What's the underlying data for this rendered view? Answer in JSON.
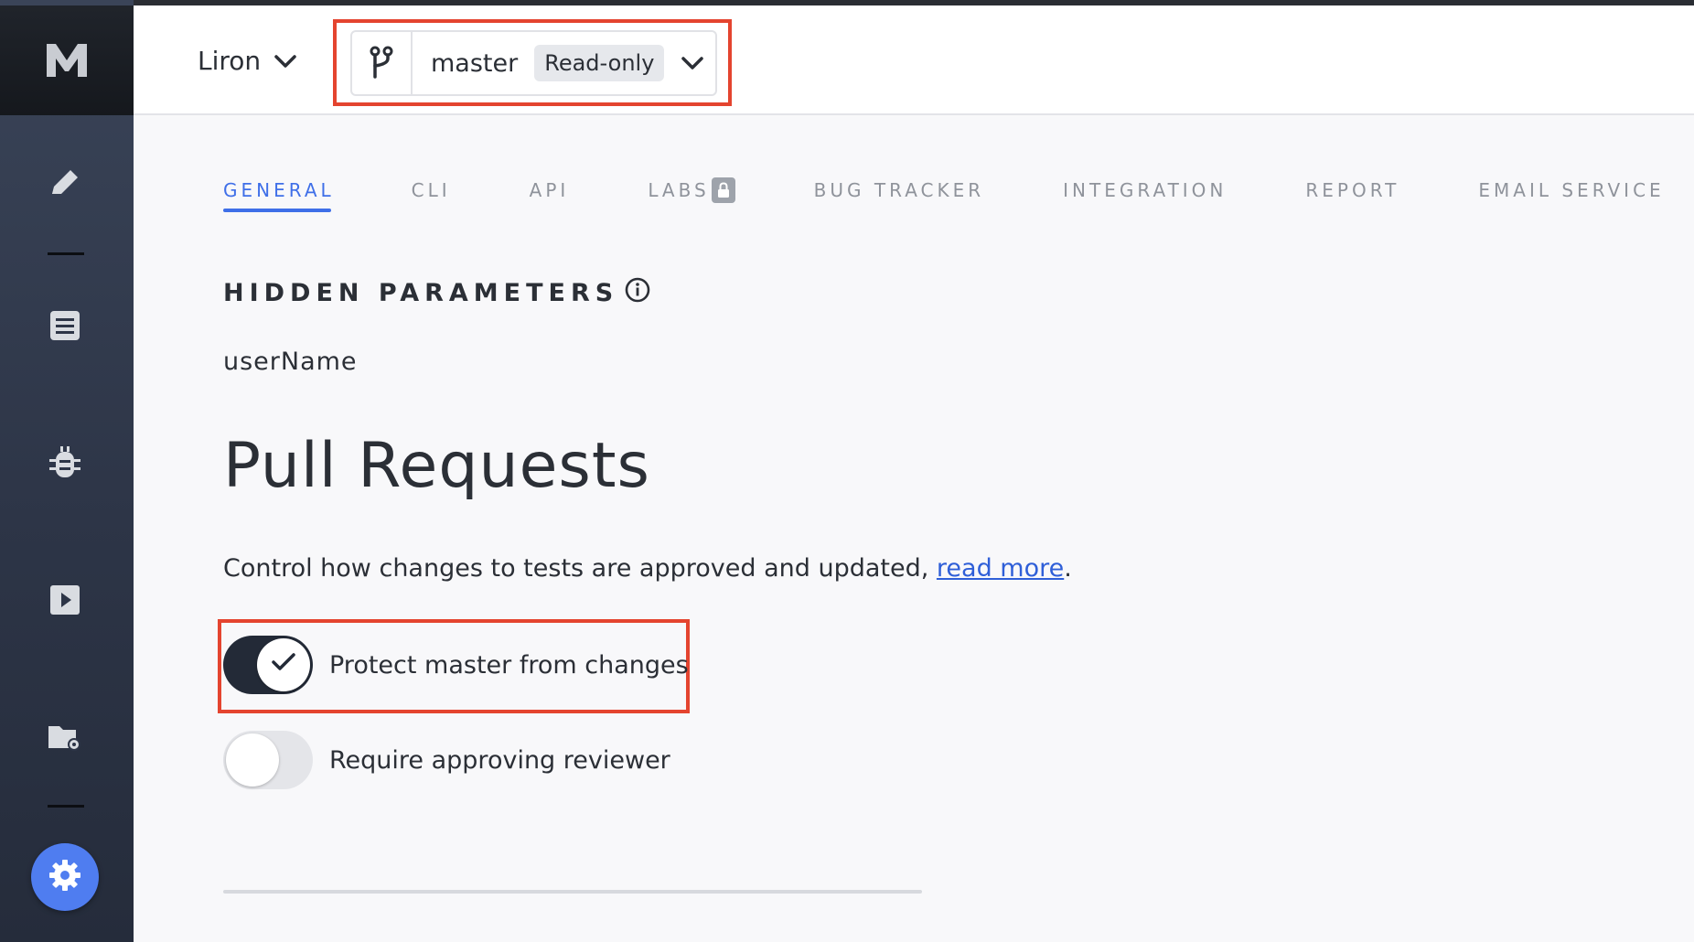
{
  "header": {
    "project_name": "Liron",
    "branch_name": "master",
    "branch_badge": "Read-only"
  },
  "tabs": [
    {
      "label": "GENERAL",
      "active": true
    },
    {
      "label": "CLI",
      "active": false
    },
    {
      "label": "API",
      "active": false
    },
    {
      "label": "LABS",
      "active": false,
      "locked": true
    },
    {
      "label": "BUG TRACKER",
      "active": false
    },
    {
      "label": "INTEGRATION",
      "active": false
    },
    {
      "label": "REPORT",
      "active": false
    },
    {
      "label": "EMAIL SERVICE",
      "active": false
    }
  ],
  "hidden_parameters": {
    "title": "HIDDEN PARAMETERS",
    "items": [
      "userName"
    ]
  },
  "pull_requests": {
    "heading": "Pull Requests",
    "description": "Control how changes to tests are approved and updated, ",
    "link_text": "read more",
    "description_end": ".",
    "toggles": [
      {
        "label": "Protect master from changes",
        "on": true
      },
      {
        "label": "Require approving reviewer",
        "on": false
      }
    ]
  },
  "sidebar": {
    "icons": [
      "logo-icon",
      "pencil-icon",
      "list-icon",
      "bug-icon",
      "play-icon",
      "folder-settings-icon",
      "gear-icon"
    ]
  },
  "colors": {
    "accent": "#3f6fe8",
    "highlight": "#e4442f",
    "sidebar": "#2d3547",
    "settings_button": "#4f7df0"
  }
}
